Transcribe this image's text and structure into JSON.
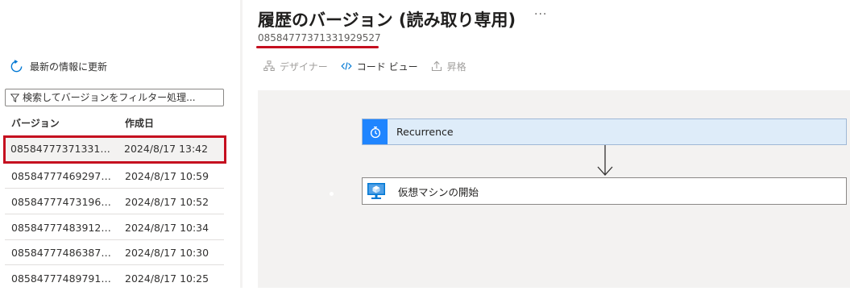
{
  "sidebar": {
    "refresh_label": "最新の情報に更新",
    "filter_placeholder": "検索してバージョンをフィルター処理...",
    "col_version": "バージョン",
    "col_created": "作成日",
    "rows": [
      {
        "version": "08584777371331…",
        "date": "2024/8/17 13:42"
      },
      {
        "version": "08584777469297…",
        "date": "2024/8/17 10:59"
      },
      {
        "version": "08584777473196…",
        "date": "2024/8/17 10:52"
      },
      {
        "version": "08584777483912…",
        "date": "2024/8/17 10:34"
      },
      {
        "version": "08584777486387…",
        "date": "2024/8/17 10:30"
      },
      {
        "version": "08584777489791…",
        "date": "2024/8/17 10:25"
      }
    ]
  },
  "header": {
    "title": "履歴のバージョン (読み取り専用)",
    "more": "···",
    "version_id": "08584777371331929527"
  },
  "toolbar": {
    "designer": "デザイナー",
    "code_view": "コード ビュー",
    "promote": "昇格"
  },
  "canvas": {
    "step1": "Recurrence",
    "step2": "仮想マシンの開始"
  },
  "icons": {
    "refresh": "refresh-icon",
    "filter": "filter-icon",
    "designer": "designer-icon",
    "code": "code-icon",
    "promote": "promote-icon",
    "recurrence": "clock-icon",
    "vm": "virtual-machine-icon"
  },
  "colors": {
    "accent": "#0078d4",
    "highlight_red": "#c50f1f",
    "recurrence_blue": "#1f85ff",
    "canvas_bg": "#f3f2f1"
  }
}
